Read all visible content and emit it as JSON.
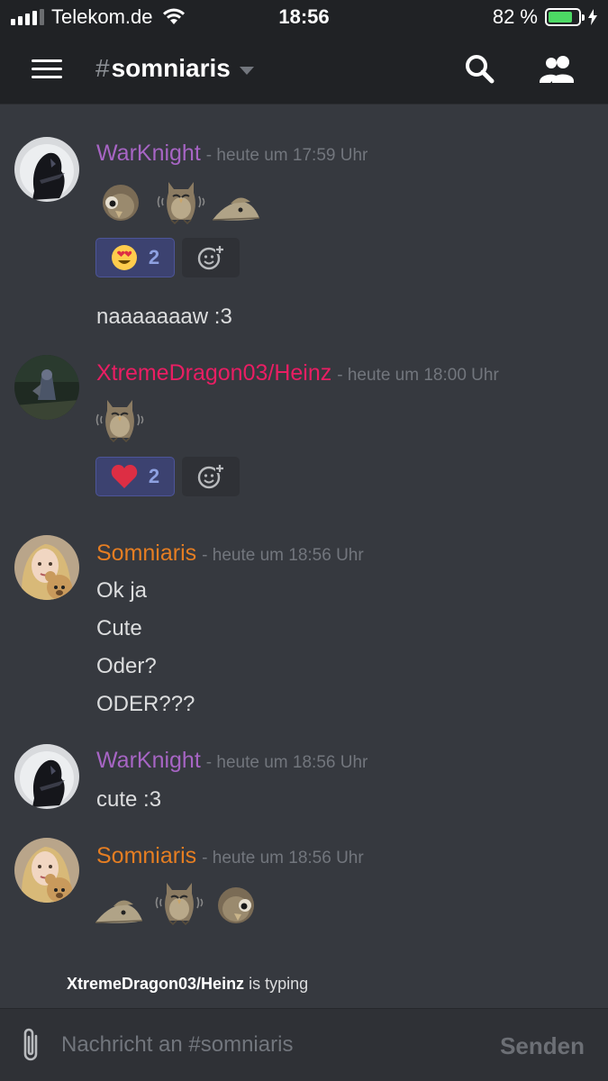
{
  "status_bar": {
    "carrier": "Telekom.de",
    "time": "18:56",
    "battery_percent": "82 %",
    "battery_level": 0.82
  },
  "header": {
    "channel_hash": "#",
    "channel_name": "somniaris",
    "icons": [
      "menu-icon",
      "chevron-down-icon",
      "search-icon",
      "members-icon"
    ]
  },
  "messages": [
    {
      "author": "WarKnight",
      "author_color": "#a765c4",
      "timestamp": "- heute um 17:59 Uhr",
      "emotes": [
        "owl-bowing-emote",
        "owl-shaking-emote",
        "owl-lying-emote"
      ],
      "reactions": [
        {
          "emoji": "heart-eyes-emoji",
          "count": "2"
        }
      ],
      "lines": [
        "naaaaaaaw :3"
      ]
    },
    {
      "author": "XtremeDragon03/Heinz",
      "author_color": "#e91e63",
      "timestamp": "- heute um 18:00 Uhr",
      "emotes": [
        "owl-shaking-emote"
      ],
      "reactions": [
        {
          "emoji": "red-heart-emoji",
          "count": "2"
        }
      ],
      "lines": []
    },
    {
      "author": "Somniaris",
      "author_color": "#e67e22",
      "timestamp": "- heute um 18:56 Uhr",
      "emotes": [],
      "reactions": [],
      "lines": [
        "Ok ja",
        "Cute",
        "Oder?",
        "ODER???"
      ]
    },
    {
      "author": "WarKnight",
      "author_color": "#a765c4",
      "timestamp": "- heute um 18:56 Uhr",
      "emotes": [],
      "reactions": [],
      "lines": [
        "cute :3"
      ]
    },
    {
      "author": "Somniaris",
      "author_color": "#e67e22",
      "timestamp": "- heute um 18:56 Uhr",
      "emotes": [
        "owl-lying-emote",
        "owl-shaking-emote",
        "owl-bowing-emote"
      ],
      "reactions": [],
      "lines": []
    }
  ],
  "typing": {
    "user": "XtremeDragon03/Heinz",
    "text": " is typing"
  },
  "composer": {
    "placeholder": "Nachricht an #somniaris",
    "value": "",
    "send_label": "Senden"
  }
}
